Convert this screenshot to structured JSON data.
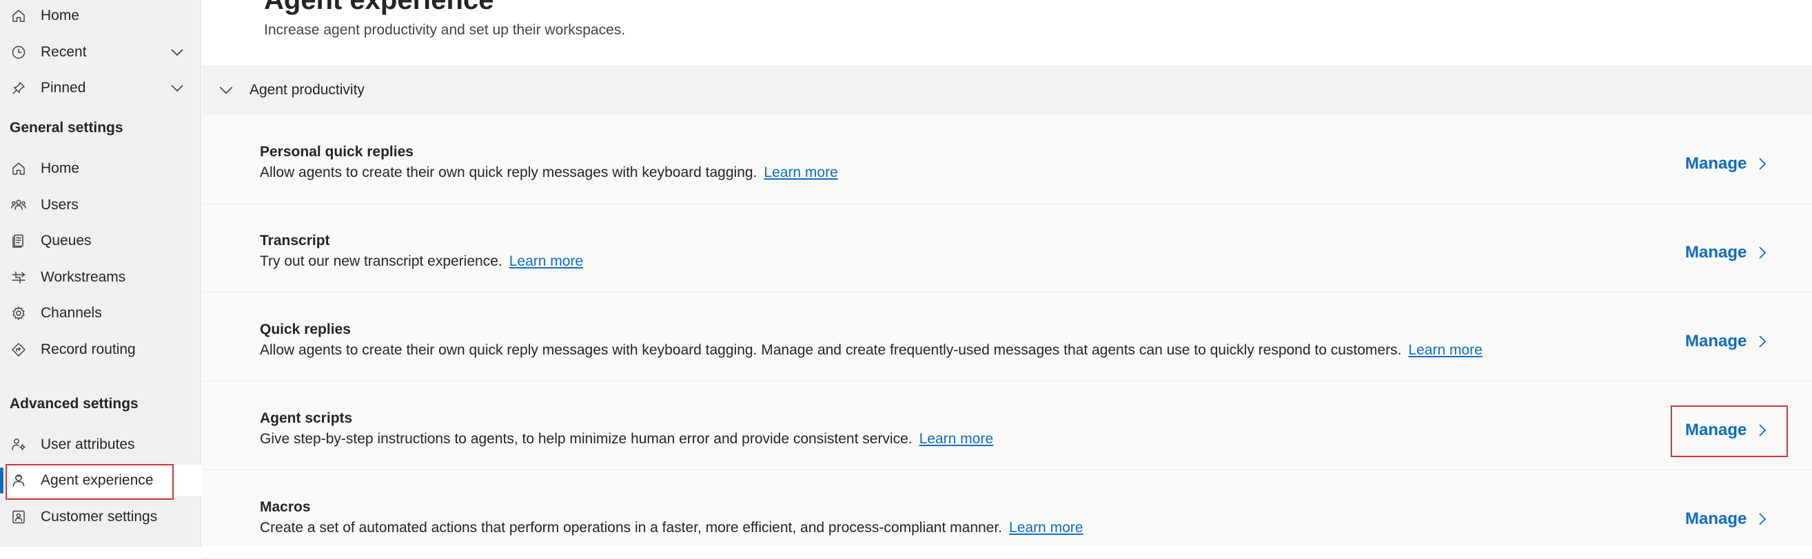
{
  "sidebar": {
    "top_items": [
      {
        "label": "Home",
        "icon": "home-icon"
      },
      {
        "label": "Recent",
        "icon": "clock-icon",
        "expandable": true
      },
      {
        "label": "Pinned",
        "icon": "pin-icon",
        "expandable": true
      }
    ],
    "general_heading": "General settings",
    "general_items": [
      {
        "label": "Home",
        "icon": "home-icon"
      },
      {
        "label": "Users",
        "icon": "people-icon"
      },
      {
        "label": "Queues",
        "icon": "queue-icon"
      },
      {
        "label": "Workstreams",
        "icon": "workstream-icon"
      },
      {
        "label": "Channels",
        "icon": "gear-icon"
      },
      {
        "label": "Record routing",
        "icon": "routing-icon"
      }
    ],
    "advanced_heading": "Advanced settings",
    "advanced_items": [
      {
        "label": "User attributes",
        "icon": "user-attributes-icon"
      },
      {
        "label": "Agent experience",
        "icon": "agent-icon",
        "selected": true
      },
      {
        "label": "Customer settings",
        "icon": "customer-icon"
      }
    ]
  },
  "main": {
    "title": "Agent experience",
    "subtitle": "Increase agent productivity and set up their workspaces.",
    "section": {
      "title": "Agent productivity",
      "expanded": true
    },
    "rows": [
      {
        "name": "Personal quick replies",
        "description": "Allow agents to create their own quick reply messages with keyboard tagging.",
        "link": "Learn more",
        "action": "Manage"
      },
      {
        "name": "Transcript",
        "description": "Try out our new transcript experience.",
        "link": "Learn more",
        "action": "Manage"
      },
      {
        "name": "Quick replies",
        "description": "Allow agents to create their own quick reply messages with keyboard tagging. Manage and create frequently-used messages that agents can use to quickly respond to customers.",
        "link": "Learn more",
        "action": "Manage"
      },
      {
        "name": "Agent scripts",
        "description": "Give step-by-step instructions to agents, to help minimize human error and provide consistent service.",
        "link": "Learn more",
        "action": "Manage",
        "highlighted": true
      },
      {
        "name": "Macros",
        "description": "Create a set of automated actions that perform operations in a faster, more efficient, and process-compliant manner.",
        "link": "Learn more",
        "action": "Manage"
      }
    ]
  },
  "colors": {
    "accent": "#0f6cbd",
    "highlight": "#d13438",
    "sidebar_bg": "#f0f0f0",
    "section_bg": "#f2f2f2",
    "list_bg": "#faf9f8"
  }
}
